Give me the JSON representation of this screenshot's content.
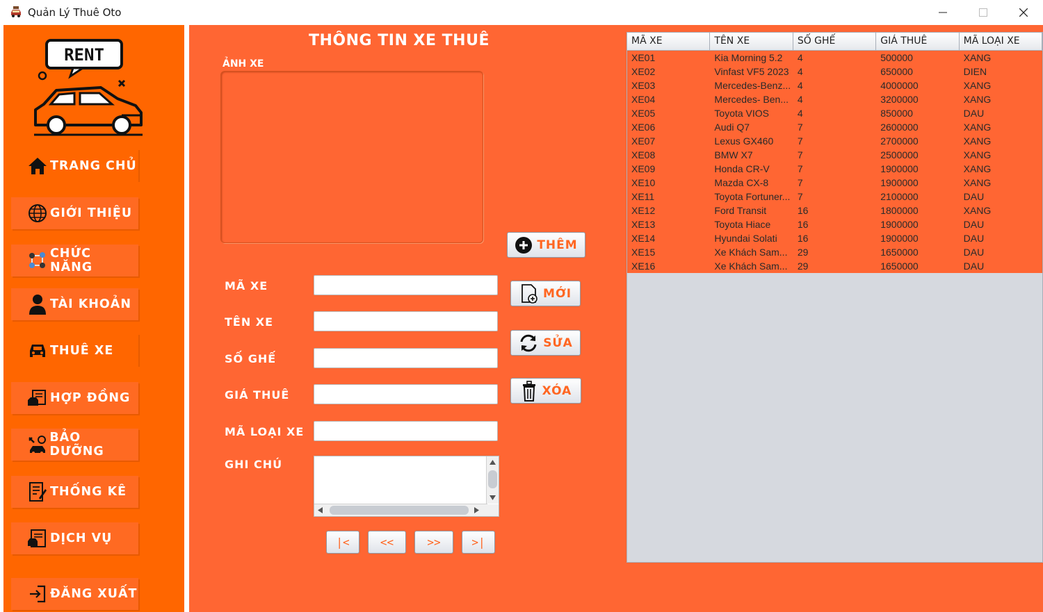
{
  "window": {
    "title": "Quản Lý Thuê Oto"
  },
  "sidebar": {
    "logo_text": "RENT",
    "items": [
      {
        "label": "TRANG CHỦ",
        "icon": "home-icon"
      },
      {
        "label": "GIỚI THIỆU",
        "icon": "globe-icon"
      },
      {
        "label": "CHỨC NĂNG",
        "icon": "functions-icon"
      },
      {
        "label": "TÀI KHOẢN",
        "icon": "user-icon"
      },
      {
        "label": "THUÊ XE",
        "icon": "car-icon"
      },
      {
        "label": "HỢP ĐỒNG",
        "icon": "contract-icon"
      },
      {
        "label": "BẢO DƯỠNG",
        "icon": "maintenance-icon"
      },
      {
        "label": "THỐNG KÊ",
        "icon": "statistics-icon"
      },
      {
        "label": "DỊCH VỤ",
        "icon": "service-icon"
      },
      {
        "label": "ĐĂNG XUẤT",
        "icon": "logout-icon"
      }
    ]
  },
  "form": {
    "title": "THÔNG TIN XE THUÊ",
    "image_label": "ẢNH XE",
    "fields": {
      "ma_xe": {
        "label": "MÃ XE",
        "value": ""
      },
      "ten_xe": {
        "label": "TÊN XE",
        "value": ""
      },
      "so_ghe": {
        "label": "SỐ GHẾ",
        "value": ""
      },
      "gia_thue": {
        "label": "GIÁ THUÊ",
        "value": ""
      },
      "ma_loai_xe": {
        "label": "MÃ LOẠI XE",
        "value": ""
      },
      "ghi_chu": {
        "label": "GHI CHÚ",
        "value": ""
      }
    },
    "buttons": {
      "add": "THÊM",
      "new": "MỚI",
      "edit": "SỬA",
      "delete": "XÓA"
    },
    "pager": {
      "first": "|<",
      "prev": "<<",
      "next": ">>",
      "last": ">|"
    }
  },
  "table": {
    "columns": [
      "MÃ XE",
      "TÊN XE",
      "SỐ GHẾ",
      "GIÁ THUÊ",
      "MÃ LOẠI XE"
    ],
    "rows": [
      [
        "XE01",
        "Kia Morning 5.2",
        "4",
        "500000",
        "XANG"
      ],
      [
        "XE02",
        "Vinfast VF5 2023",
        "4",
        "650000",
        "DIEN"
      ],
      [
        "XE03",
        "Mercedes-Benz...",
        "4",
        "4000000",
        "XANG"
      ],
      [
        "XE04",
        "Mercedes- Ben...",
        "4",
        "3200000",
        "XANG"
      ],
      [
        "XE05",
        "Toyota VIOS",
        "4",
        "850000",
        "DAU"
      ],
      [
        "XE06",
        "Audi Q7",
        "7",
        "2600000",
        "XANG"
      ],
      [
        "XE07",
        "Lexus GX460",
        "7",
        "2700000",
        "XANG"
      ],
      [
        "XE08",
        "BMW X7",
        "7",
        "2500000",
        "XANG"
      ],
      [
        "XE09",
        "Honda CR-V",
        "7",
        "1900000",
        "XANG"
      ],
      [
        "XE10",
        "Mazda CX-8",
        "7",
        "1900000",
        "XANG"
      ],
      [
        "XE11",
        "Toyota Fortuner...",
        "7",
        "2100000",
        "DAU"
      ],
      [
        "XE12",
        "Ford Transit",
        "16",
        "1800000",
        "XANG"
      ],
      [
        "XE13",
        "Toyota Hiace",
        "16",
        "1900000",
        "DAU"
      ],
      [
        "XE14",
        "Hyundai Solati",
        "16",
        "1900000",
        "DAU"
      ],
      [
        "XE15",
        "Xe Khách Sam...",
        "29",
        "1650000",
        "DAU"
      ],
      [
        "XE16",
        "Xe Khách Sam...",
        "29",
        "1650000",
        "DAU"
      ]
    ]
  },
  "colors": {
    "sidebar": "#ff6600",
    "main": "#ff6633",
    "accent": "#ff6622"
  }
}
